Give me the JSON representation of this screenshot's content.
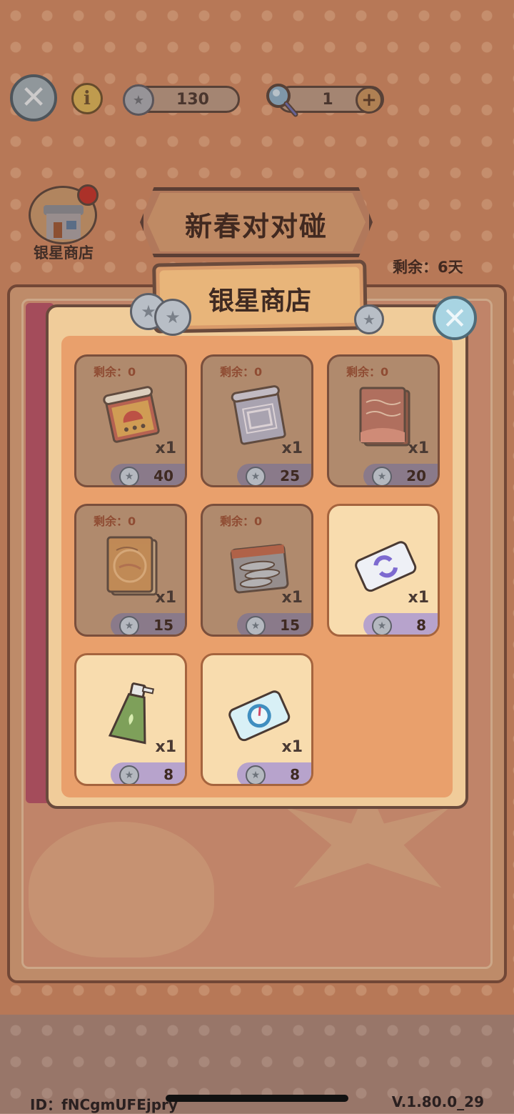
{
  "top_bar": {
    "silver_star_count": "130",
    "magnifier_count": "1",
    "close_icon": "close-icon",
    "info_glyph": "i",
    "plus_glyph": "+"
  },
  "event": {
    "title": "新春对对碰",
    "remaining_time": "剩余：6天"
  },
  "shop_shortcut": {
    "label": "银星商店"
  },
  "shop_panel": {
    "title": "银星商店",
    "items": [
      {
        "remain": "剩余：0",
        "quantity": "x1",
        "price": "40",
        "icon": "scroll-icon",
        "sold_out": true
      },
      {
        "remain": "剩余：0",
        "quantity": "x1",
        "price": "25",
        "icon": "blueprint-icon",
        "sold_out": true
      },
      {
        "remain": "剩余：0",
        "quantity": "x1",
        "price": "20",
        "icon": "recipe-book-icon",
        "sold_out": true
      },
      {
        "remain": "剩余：0",
        "quantity": "x1",
        "price": "15",
        "icon": "map-book-icon",
        "sold_out": true
      },
      {
        "remain": "剩余：0",
        "quantity": "x1",
        "price": "15",
        "icon": "fish-tray-icon",
        "sold_out": true
      },
      {
        "remain": "",
        "quantity": "x1",
        "price": "8",
        "icon": "refresh-ticket-icon",
        "sold_out": false
      },
      {
        "remain": "",
        "quantity": "x1",
        "price": "8",
        "icon": "spray-bottle-icon",
        "sold_out": false
      },
      {
        "remain": "",
        "quantity": "x1",
        "price": "8",
        "icon": "clock-ticket-icon",
        "sold_out": false
      }
    ]
  },
  "footer": {
    "player_id": "ID：fNCgmUFEjpry",
    "version": "V.1.80.0_29"
  },
  "colors": {
    "background": "#cf8a65",
    "panel": "#f0cc9a",
    "price_pill": "#b7a3cc",
    "sold_out_card": "#b08a6d"
  }
}
